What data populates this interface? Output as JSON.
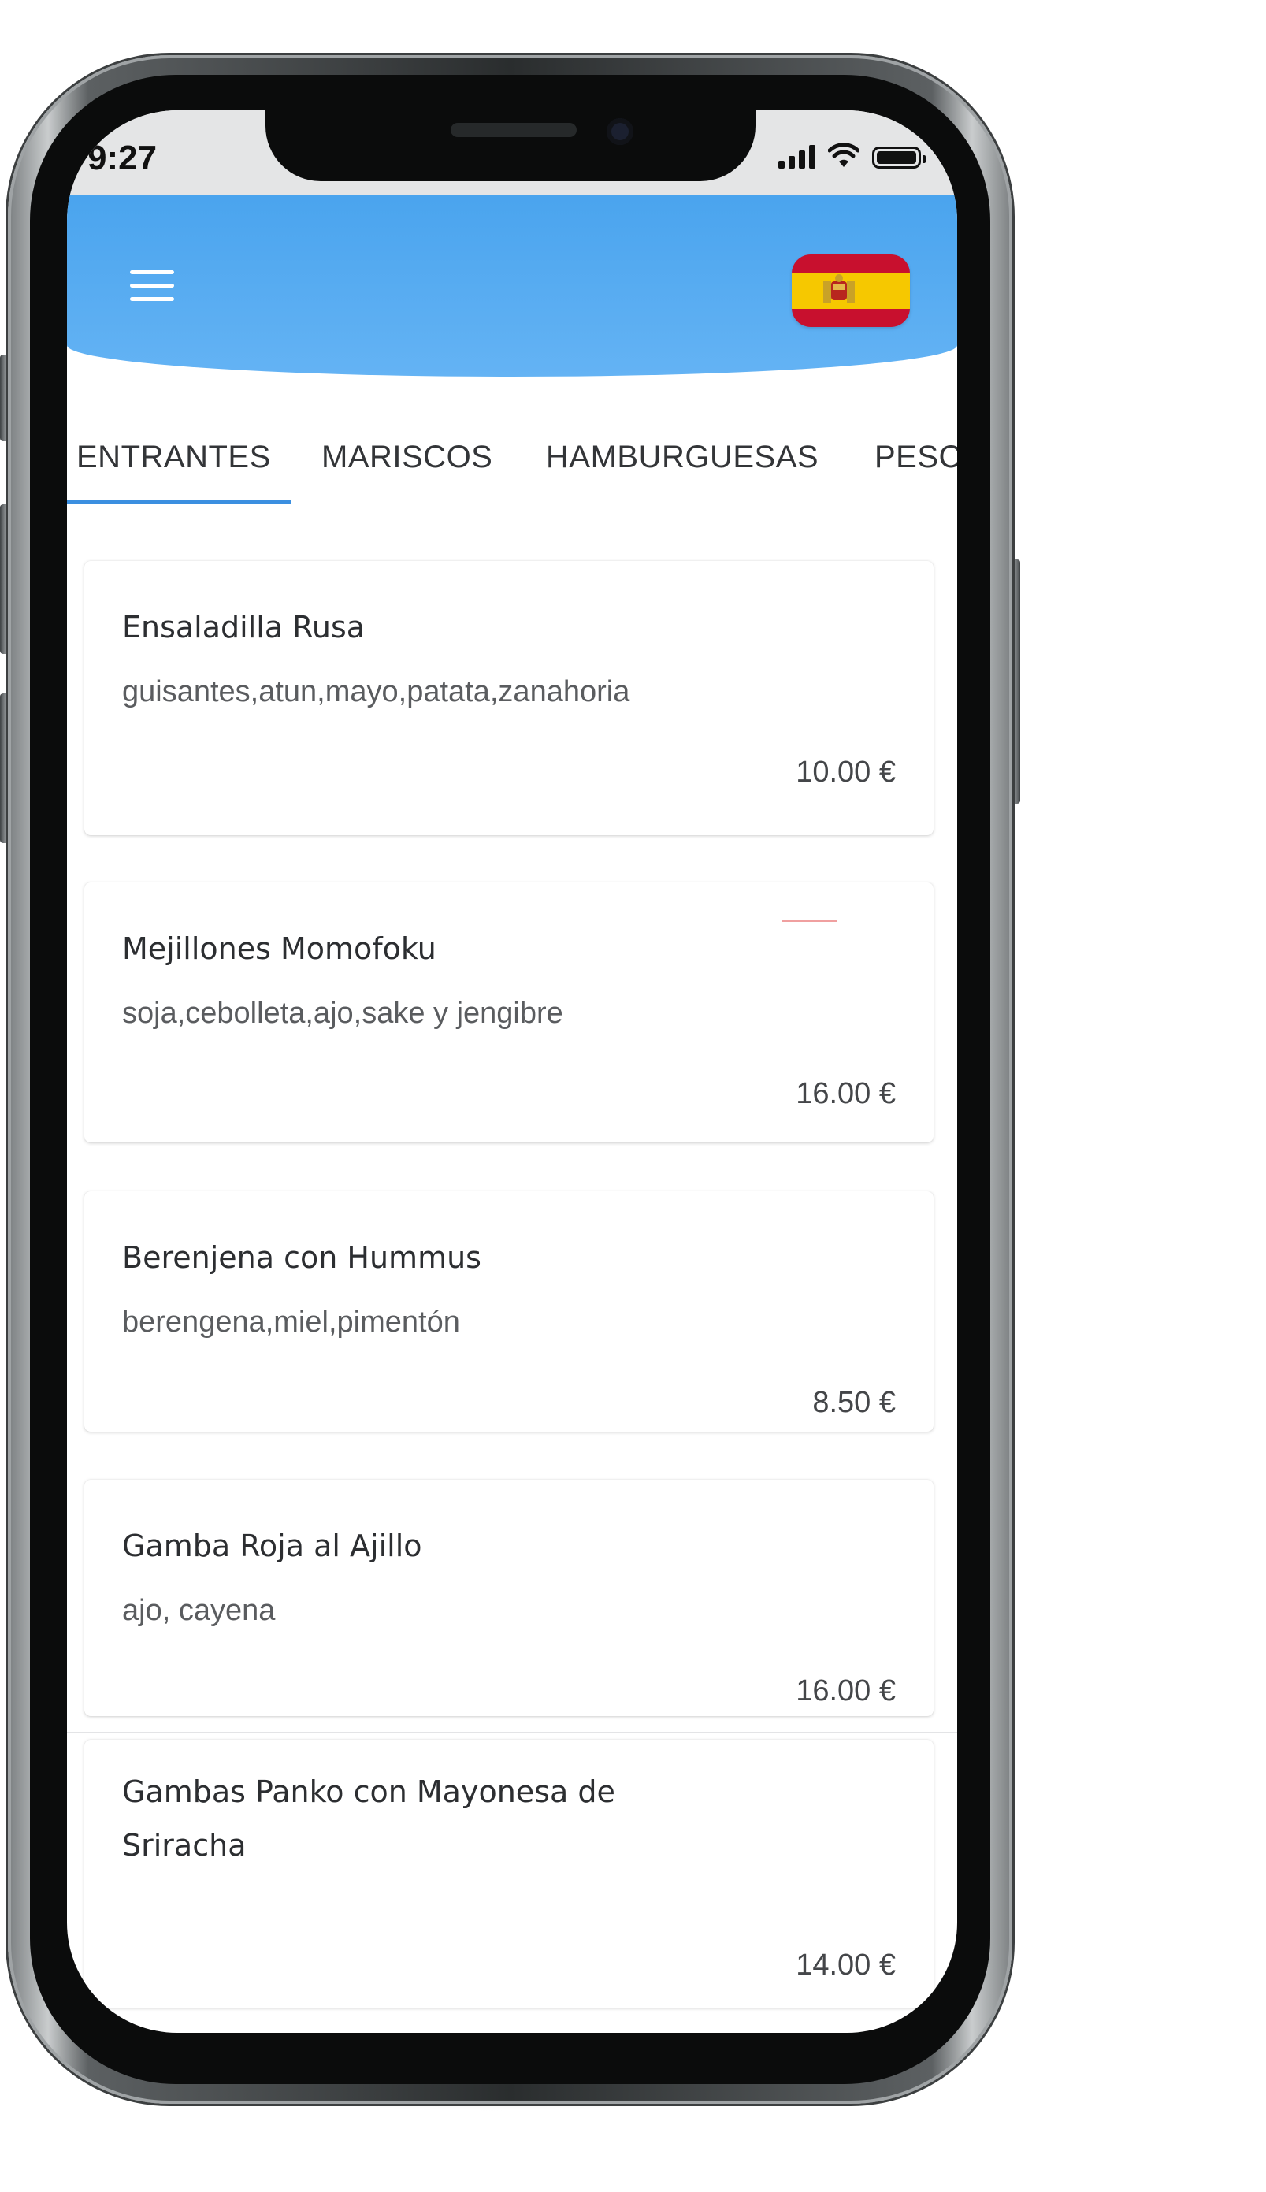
{
  "status_bar": {
    "time": "9:27"
  },
  "header": {
    "menu_icon": "hamburger-menu-icon",
    "language_flag": "spain-flag-icon",
    "accent_color": "#4aa4ee"
  },
  "tabs": [
    {
      "label": "ENTRANTES",
      "active": true
    },
    {
      "label": "MARISCOS",
      "active": false
    },
    {
      "label": "HAMBURGUESAS",
      "active": false
    },
    {
      "label": "PESCA",
      "active": false
    }
  ],
  "menu_items": [
    {
      "name": "Ensaladilla Rusa",
      "ingredients": "guisantes,atun,mayo,patata,zanahoria",
      "price": "10.00 €"
    },
    {
      "name": "Mejillones Momofoku",
      "ingredients": "soja,cebolleta,ajo,sake y jengibre",
      "price": "16.00 €"
    },
    {
      "name": "Berenjena con Hummus",
      "ingredients": "berengena,miel,pimentón",
      "price": "8.50 €"
    },
    {
      "name": "Gamba Roja al Ajillo",
      "ingredients": "ajo, cayena",
      "price": "16.00 €"
    },
    {
      "name": "Gambas Panko con Mayonesa de Sriracha",
      "ingredients": "",
      "price": "14.00 €"
    }
  ]
}
